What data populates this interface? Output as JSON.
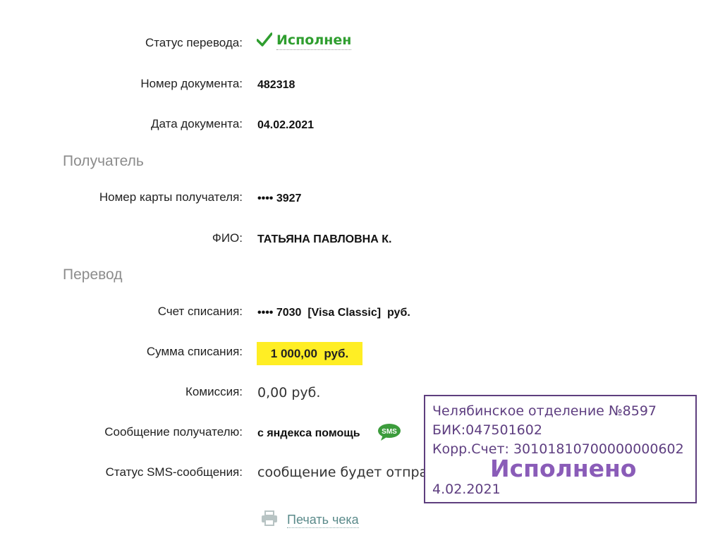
{
  "rows": {
    "status": {
      "label": "Статус перевода:",
      "value": "Исполнен"
    },
    "doc_number": {
      "label": "Номер документа:",
      "value": "482318"
    },
    "doc_date": {
      "label": "Дата документа:",
      "value": "04.02.2021"
    }
  },
  "recipient": {
    "heading": "Получатель",
    "card": {
      "label": "Номер карты получателя:",
      "value": "•••• 3927"
    },
    "name": {
      "label": "ФИО:",
      "value": "ТАТЬЯНА ПАВЛОВНА К."
    }
  },
  "transfer": {
    "heading": "Перевод",
    "account": {
      "label": "Счет списания:",
      "value": "•••• 7030  [Visa Classic]  руб."
    },
    "amount": {
      "label": "Сумма списания:",
      "value": "1 000,00  руб."
    },
    "commission": {
      "label": "Комиссия:",
      "value": "0,00 руб."
    },
    "message": {
      "label": "Сообщение получателю:",
      "value": "с яндекса помощь",
      "badge": "SMS"
    },
    "sms_status": {
      "label": "Статус SMS-сообщения:",
      "value": "сообщение будет отправлено"
    }
  },
  "print_label": "Печать чека",
  "stamp": {
    "line1": "Челябинское отделение №8597",
    "line2": "БИК:047501602",
    "line3": "Корр.Счет: 30101810700000000602",
    "status": "Исполнено",
    "date": "4.02.2021"
  },
  "colors": {
    "accent_green": "#2f9e2f",
    "amount_highlight": "#ffee24",
    "stamp_purple": "#5e3e80"
  },
  "icons": {
    "status": "checkmark-icon",
    "sms": "sms-bubble-icon",
    "print": "printer-icon"
  }
}
